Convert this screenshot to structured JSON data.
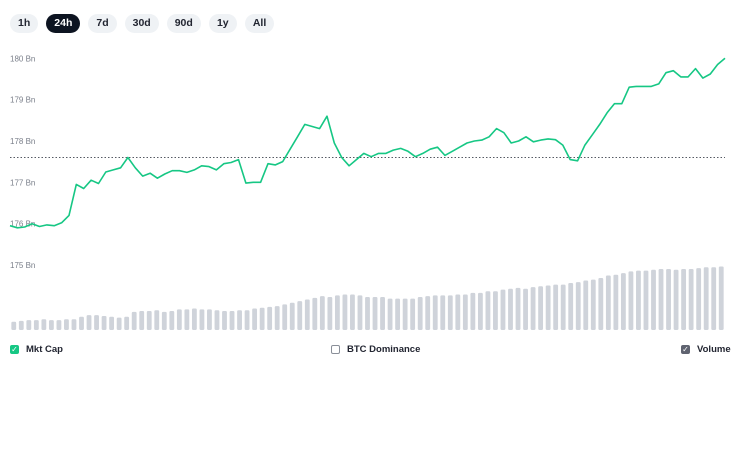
{
  "range_buttons": [
    "1h",
    "24h",
    "7d",
    "30d",
    "90d",
    "1y",
    "All"
  ],
  "active_range": "24h",
  "legend": {
    "mkt_cap": {
      "label": "Mkt Cap",
      "checked": true
    },
    "btc_dominance": {
      "label": "BTC Dominance",
      "checked": false
    },
    "volume": {
      "label": "Volume",
      "checked": true
    }
  },
  "colors": {
    "line": "#16c784",
    "volume_bars": "#cfd3da",
    "reference_line": "#555a63",
    "active_button": "#0d1421",
    "button_bg": "#eff2f5"
  },
  "chart_data": [
    {
      "type": "line",
      "title": "",
      "xlabel": "",
      "ylabel": "",
      "y_ticks": [
        "180 Bn",
        "179 Bn",
        "178 Bn",
        "177 Bn",
        "176 Bn",
        "175 Bn"
      ],
      "y_tick_values": [
        180,
        179,
        178,
        177,
        176,
        175
      ],
      "ylim": [
        175,
        180.2
      ],
      "grid": false,
      "reference_line": 177.6,
      "series": [
        {
          "values": [
            175.95,
            175.9,
            175.92,
            176.0,
            175.93,
            175.97,
            175.95,
            176.02,
            176.2,
            176.95,
            176.85,
            177.05,
            176.97,
            177.25,
            177.3,
            177.35,
            177.6,
            177.35,
            177.15,
            177.22,
            177.1,
            177.2,
            177.28,
            177.28,
            177.24,
            177.3,
            177.4,
            177.38,
            177.3,
            177.45,
            177.48,
            177.55,
            176.98,
            177.0,
            177.0,
            177.45,
            177.42,
            177.5,
            177.8,
            178.1,
            178.4,
            178.35,
            178.3,
            178.6,
            177.95,
            177.6,
            177.4,
            177.55,
            177.7,
            177.62,
            177.7,
            177.7,
            177.78,
            177.82,
            177.75,
            177.62,
            177.7,
            177.8,
            177.85,
            177.65,
            177.75,
            177.85,
            177.95,
            178.0,
            178.02,
            178.1,
            178.3,
            178.2,
            177.95,
            178.0,
            178.1,
            177.98,
            178.02,
            178.05,
            178.03,
            177.9,
            177.55,
            177.52,
            177.9,
            178.15,
            178.4,
            178.68,
            178.9,
            178.9,
            179.3,
            179.32,
            179.32,
            179.32,
            179.38,
            179.65,
            179.7,
            179.55,
            179.55,
            179.75,
            179.52,
            179.62,
            179.85,
            180.0
          ]
        }
      ]
    },
    {
      "type": "bar",
      "title": "",
      "series": [
        {
          "values": [
            10,
            11,
            12,
            12,
            13,
            12,
            12,
            13,
            13,
            16,
            18,
            18,
            17,
            16,
            15,
            16,
            22,
            23,
            23,
            24,
            22,
            23,
            25,
            25,
            26,
            25,
            25,
            24,
            23,
            23,
            24,
            24,
            26,
            27,
            28,
            29,
            31,
            33,
            35,
            37,
            39,
            41,
            40,
            42,
            43,
            43,
            42,
            40,
            40,
            40,
            38,
            38,
            38,
            38,
            40,
            41,
            42,
            42,
            42,
            43,
            43,
            45,
            45,
            47,
            47,
            49,
            50,
            51,
            50,
            52,
            53,
            54,
            55,
            55,
            57,
            58,
            60,
            61,
            63,
            66,
            67,
            69,
            71,
            72,
            72,
            73,
            74,
            74,
            73,
            74,
            74,
            75,
            76,
            76,
            77
          ]
        }
      ]
    }
  ]
}
